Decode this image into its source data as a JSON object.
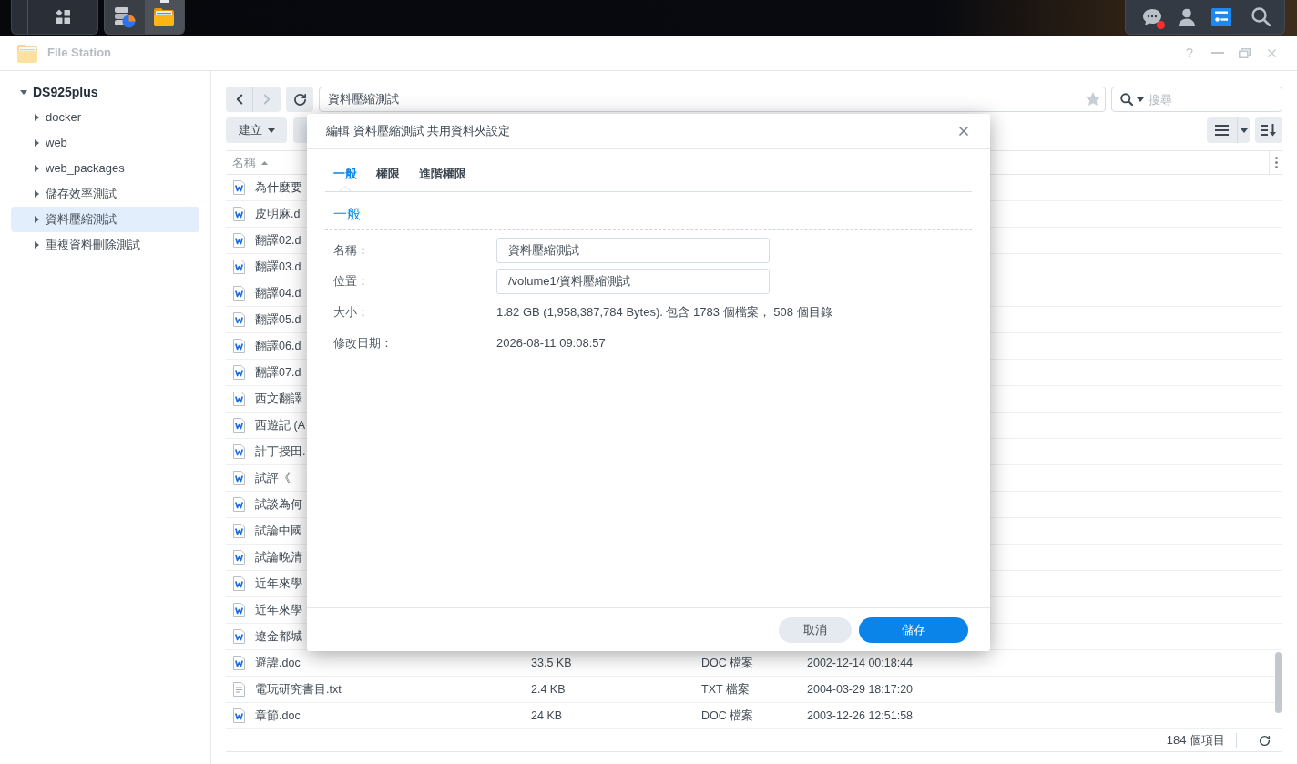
{
  "taskbar": {
    "apps": [
      {
        "kind": "storage",
        "selected": false
      },
      {
        "kind": "folder",
        "selected": true
      }
    ],
    "tray": [
      {
        "kind": "chat",
        "selected": false,
        "badge": true
      },
      {
        "kind": "user",
        "selected": false,
        "badge": false
      },
      {
        "kind": "widgets",
        "selected": true,
        "badge": false
      },
      {
        "kind": "search",
        "selected": false,
        "badge": false
      }
    ]
  },
  "window": {
    "title": "File Station",
    "active": false,
    "help": "?"
  },
  "sidebar": {
    "root": {
      "label": "DS925plus",
      "expanded": true,
      "selected": false,
      "children": [
        {
          "label": "docker",
          "expanded": false,
          "selected": false
        },
        {
          "label": "web",
          "expanded": false,
          "selected": false
        },
        {
          "label": "web_packages",
          "expanded": false,
          "selected": false
        },
        {
          "label": "儲存效率測試",
          "expanded": false,
          "selected": false
        },
        {
          "label": "資料壓縮測試",
          "expanded": false,
          "selected": true
        },
        {
          "label": "重複資料刪除測試",
          "expanded": false,
          "selected": false
        }
      ]
    }
  },
  "toolbar": {
    "back": {
      "disabled": false
    },
    "forward": {
      "disabled": true
    },
    "path": "資料壓縮測試",
    "favorite": false,
    "search_placeholder": "搜尋",
    "create": "建立"
  },
  "file_list": {
    "columns": [
      {
        "label": "名稱",
        "sort_descending": false
      }
    ],
    "rows": [
      {
        "kind": "doc",
        "name": "為什麼要"
      },
      {
        "kind": "doc",
        "name": "皮明麻.d"
      },
      {
        "kind": "doc",
        "name": "翻譯02.d"
      },
      {
        "kind": "doc",
        "name": "翻譯03.d"
      },
      {
        "kind": "doc",
        "name": "翻譯04.d"
      },
      {
        "kind": "doc",
        "name": "翻譯05.d"
      },
      {
        "kind": "doc",
        "name": "翻譯06.d"
      },
      {
        "kind": "doc",
        "name": "翻譯07.d"
      },
      {
        "kind": "doc",
        "name": "西文翻譯"
      },
      {
        "kind": "doc",
        "name": "西遊記 (A"
      },
      {
        "kind": "doc",
        "name": "計丁授田."
      },
      {
        "kind": "doc",
        "name": "試評《"
      },
      {
        "kind": "doc",
        "name": "試談為何"
      },
      {
        "kind": "doc",
        "name": "試論中國"
      },
      {
        "kind": "doc",
        "name": "試論晚清"
      },
      {
        "kind": "doc",
        "name": "近年來學"
      },
      {
        "kind": "doc",
        "name": "近年來學"
      },
      {
        "kind": "doc",
        "name": "遼金都城"
      },
      {
        "kind": "doc",
        "name": "避諱.doc",
        "size": "33.5 KB",
        "type": "DOC 檔案",
        "modified": "2002-12-14 00:18:44"
      },
      {
        "kind": "txt",
        "name": "電玩研究書目.txt",
        "size": "2.4 KB",
        "type": "TXT 檔案",
        "modified": "2004-03-29 18:17:20"
      },
      {
        "kind": "doc",
        "name": "章節.doc",
        "size": "24 KB",
        "type": "DOC 檔案",
        "modified": "2003-12-26 12:51:58"
      }
    ]
  },
  "status_bar": {
    "count": "184 個項目"
  },
  "dialog": {
    "title": "編輯 資料壓縮測試 共用資料夾設定",
    "tabs": [
      {
        "label": "一般",
        "selected": true
      },
      {
        "label": "權限",
        "selected": false
      },
      {
        "label": "進階權限",
        "selected": false
      }
    ],
    "section": "一般",
    "fields": [
      {
        "kind": "input",
        "label": "名稱：",
        "value": "資料壓縮測試"
      },
      {
        "kind": "input",
        "label": "位置：",
        "value": "/volume1/資料壓縮測試"
      },
      {
        "kind": "text",
        "label": "大小：",
        "value": "1.82 GB (1,958,387,784 Bytes). 包含 1783 個檔案， 508 個目錄"
      },
      {
        "kind": "text",
        "label": "修改日期：",
        "value": "2026-08-11 09:08:57"
      }
    ],
    "buttons": [
      {
        "kind": "secondary",
        "label": "取消"
      },
      {
        "kind": "primary",
        "label": "儲存"
      }
    ]
  }
}
